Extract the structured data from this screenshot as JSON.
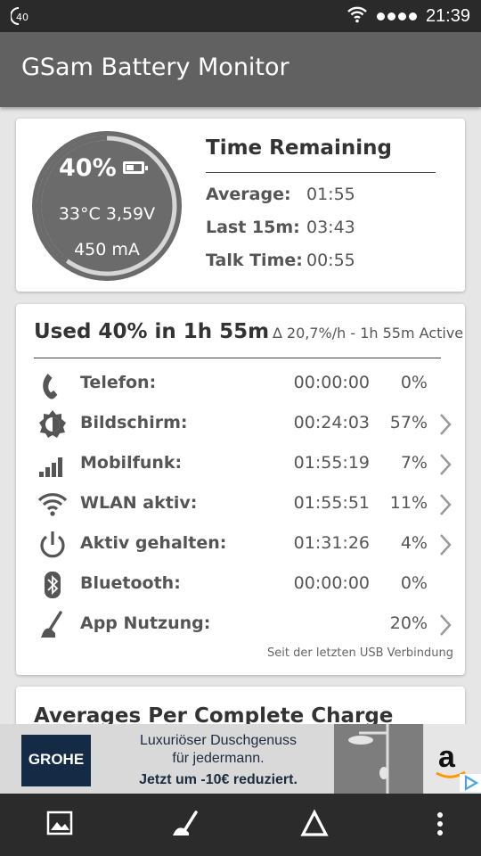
{
  "status_bar": {
    "left_badge": "40",
    "time": "21:39",
    "icons": [
      "wifi-icon",
      "signal-dots-icon"
    ]
  },
  "app_bar": {
    "title": "GSam Battery Monitor"
  },
  "battery_card": {
    "gauge": {
      "percent_label": "40%",
      "level_fraction": 0.4,
      "temp_voltage": "33°C  3,59V",
      "current": "450 mA"
    },
    "time_remaining": {
      "title": "Time Remaining",
      "rows": [
        {
          "label": "Average:",
          "value": "01:55"
        },
        {
          "label": "Last 15m:",
          "value": "03:43"
        },
        {
          "label": "Talk Time:",
          "value": "00:55"
        }
      ]
    }
  },
  "usage_card": {
    "headline": "Used 40% in 1h 55m",
    "subline": "∆ 20,7%/h - 1h 55m Active",
    "rows": [
      {
        "icon": "phone-icon",
        "name": "Telefon:",
        "time": "00:00:00",
        "percent": "0%",
        "chevron": false
      },
      {
        "icon": "brightness-icon",
        "name": "Bildschirm:",
        "time": "00:24:03",
        "percent": "57%",
        "chevron": true
      },
      {
        "icon": "cell-signal-icon",
        "name": "Mobilfunk:",
        "time": "01:55:19",
        "percent": "7%",
        "chevron": true
      },
      {
        "icon": "wifi-icon",
        "name": "WLAN aktiv:",
        "time": "01:55:51",
        "percent": "11%",
        "chevron": true
      },
      {
        "icon": "power-icon",
        "name": "Aktiv gehalten:",
        "time": "01:31:26",
        "percent": "4%",
        "chevron": true
      },
      {
        "icon": "bluetooth-icon",
        "name": "Bluetooth:",
        "time": "00:00:00",
        "percent": "0%",
        "chevron": false
      },
      {
        "icon": "app-usage-icon",
        "name": "App Nutzung:",
        "time": "",
        "percent": "20%",
        "chevron": true
      }
    ],
    "footnote": "Seit der letzten USB Verbindung"
  },
  "averages_card": {
    "title": "Averages Per Complete Charge"
  },
  "ad_banner": {
    "brand": "GROHE",
    "line1": "Luxuriöser Duschgenuss",
    "line2": "für jedermann.",
    "line3": "Jetzt um -10€ reduziert.",
    "amazon_mark": "a"
  },
  "nav_bar": {
    "items": [
      "image-icon",
      "app-usage-icon",
      "delta-icon",
      "more-vert-icon"
    ]
  },
  "colors": {
    "app_bar": "#616161",
    "status_bar": "#2a2a2a",
    "gauge_dark": "#6b6b6b",
    "gauge_light": "#d6d6d6",
    "icon_gray": "#555555"
  }
}
